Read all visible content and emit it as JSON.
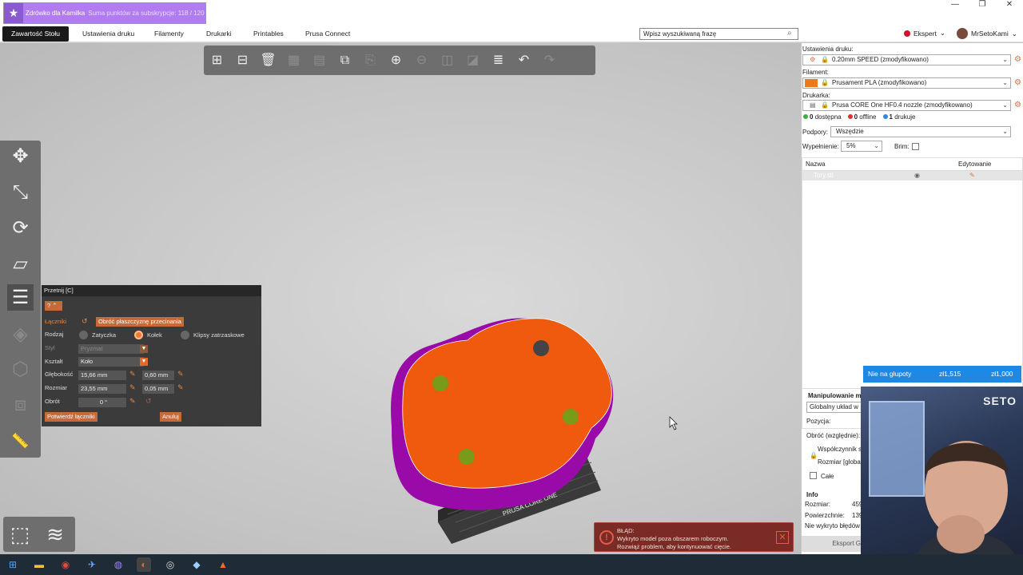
{
  "promo": {
    "title": "Zdrówko dla Kamilka",
    "subtitle": "Suma punktów za subskrypcje: 118 / 120"
  },
  "window": {
    "minimize": "—",
    "restore": "❐",
    "close": "✕"
  },
  "tabs": [
    "Zawartość Stołu",
    "Ustawienia druku",
    "Filamenty",
    "Drukarki",
    "Printables",
    "Prusa Connect"
  ],
  "search": {
    "placeholder": "Wpisz wyszukiwaną frazę"
  },
  "mode": {
    "label": "Ekspert"
  },
  "user": {
    "name": "MrSetoKami"
  },
  "cut_panel": {
    "title": "Przetnij [C]",
    "help": "?",
    "connectors_label": "Łączniki",
    "flip_plane": "Obróć płaszczyznę przecinania",
    "type_label": "Rodzaj",
    "type_options": [
      "Zatyczka",
      "Kołek",
      "Klipsy zatrzaskowe"
    ],
    "style_label": "Styl",
    "style_value": "Pryzmat",
    "shape_label": "Kształt",
    "shape_value": "Koło",
    "depth_label": "Głębokość",
    "depth_value": "15,66",
    "depth_tol": "0,60",
    "size_label": "Rozmiar",
    "size_value": "23,55",
    "size_tol": "0,05",
    "rotation_label": "Obrót",
    "rotation_value": "0 °",
    "unit": "mm",
    "confirm": "Potwierdź łączniki",
    "cancel": "Anuluj"
  },
  "bed_brand": "PRUSA CORE ONE",
  "error": {
    "title": "BŁĄD:",
    "line1": "Wykryto model poza obszarem roboczym.",
    "line2": "Rozwiąż problem, aby kontynuować cięcie."
  },
  "right_panel": {
    "print_settings_label": "Ustawienia druku:",
    "print_settings_value": "0.20mm SPEED (zmodyfikowano)",
    "filament_label": "Filament:",
    "filament_value": "Prusament PLA (zmodyfikowano)",
    "printer_label": "Drukarka:",
    "printer_value": "Prusa CORE One HF0.4 nozzle (zmodyfikowano)",
    "status": [
      {
        "count": "0",
        "text": "dostępna",
        "color": "#3cb043"
      },
      {
        "count": "0",
        "text": "offline",
        "color": "#e03030"
      },
      {
        "count": "1",
        "text": "drukuje",
        "color": "#2e8ad8"
      }
    ],
    "supports_label": "Podpory:",
    "supports_value": "Wszędzie",
    "infill_label": "Wypełnienie:",
    "infill_value": "5%",
    "brim_label": "Brim:",
    "col_name": "Nazwa",
    "col_edit": "Edytowanie",
    "object_name": "Tory.stl",
    "price_label": "Nie na głupoty",
    "price_1": "zł1,515",
    "price_2": "zł1,000",
    "manip_title": "Manipulowanie m",
    "coord_value": "Globalny układ w",
    "position_label": "Pozycja:",
    "rotate_label": "Obróć (względnie):",
    "scale_label": "Współczynnik s",
    "size_label": "Rozmiar [global",
    "whole_label": "Całe",
    "info_title": "Info",
    "info_size": "Rozmiar:",
    "info_size_v": "459",
    "info_surface": "Powierzchnie:",
    "info_surface_v": "139",
    "info_errors": "Nie wykryto błędów",
    "export": "Eksport G"
  },
  "webcam_logo": "SETO",
  "colors": {
    "accent": "#ec6a1a",
    "part_orange": "#f05a0e",
    "part_purple": "#9a0aa8",
    "connector": "#7a9a1a",
    "error_bg": "#7a2b25"
  }
}
